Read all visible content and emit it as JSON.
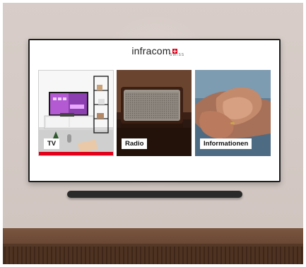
{
  "brand": {
    "name": "infracom",
    "sub": "SWISS",
    "accent_color": "#e2001a"
  },
  "menu": {
    "tiles": [
      {
        "label": "TV",
        "image": "living-room-tv-photo",
        "selected": true
      },
      {
        "label": "Radio",
        "image": "vintage-speaker-photo",
        "selected": false
      },
      {
        "label": "Informationen",
        "image": "holding-hands-photo",
        "selected": false
      }
    ]
  },
  "room": {
    "wall_color": "#d5cac5",
    "furniture": "wooden-sideboard",
    "device": "soundbar"
  }
}
